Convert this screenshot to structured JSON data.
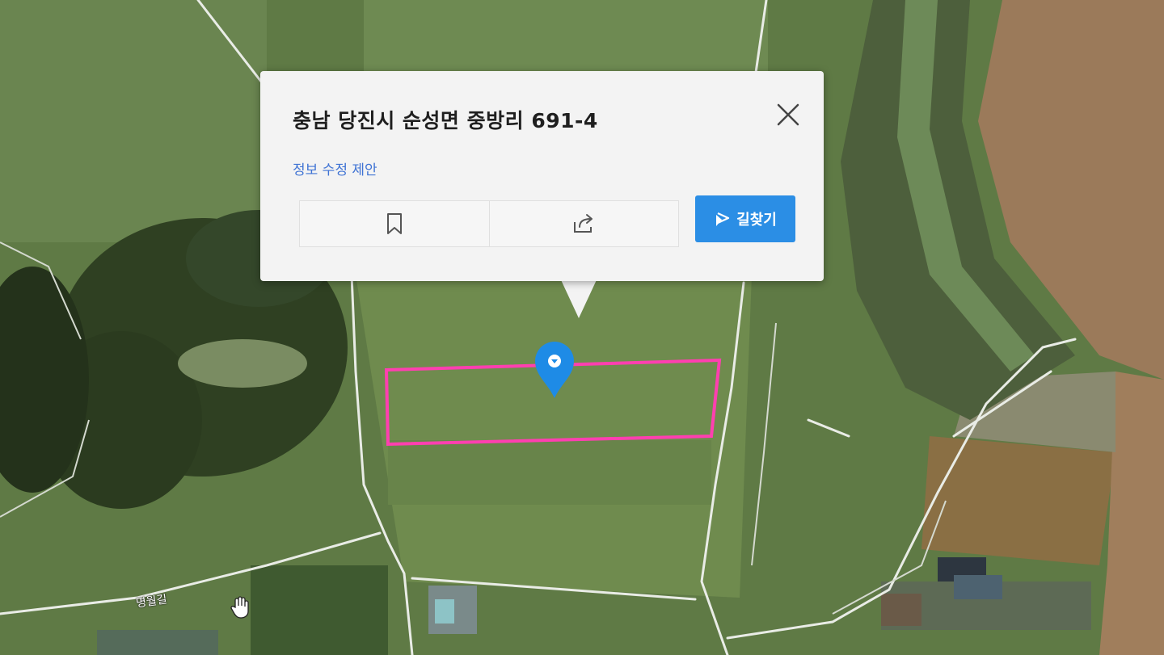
{
  "map": {
    "base_color": "#5f7a45",
    "parcel_outline_color": "#ff3fb0",
    "marker_color": "#1e8be6",
    "road_label": "명월길"
  },
  "popup": {
    "address": "충남 당진시 순성면 중방리 691-4",
    "suggest_edit": "정보 수정 제안",
    "close_icon": "close-icon",
    "save_icon": "bookmark-icon",
    "share_icon": "share-icon",
    "route_button": {
      "label": "길찾기",
      "icon": "directions-icon",
      "color": "#2b8ee5"
    }
  },
  "cursor": {
    "icon": "hand-cursor-icon"
  }
}
